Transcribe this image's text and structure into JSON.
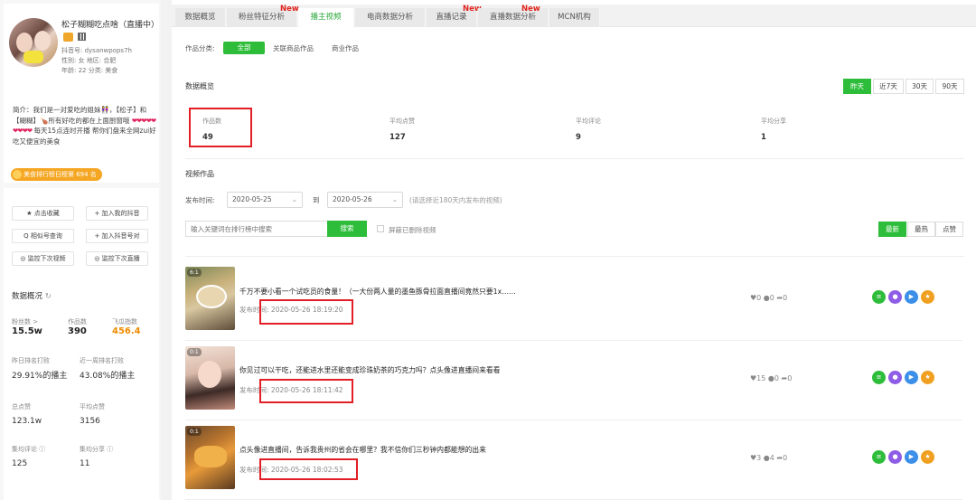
{
  "profile": {
    "name": "松子糊糊吃点啥（直播中）",
    "douyin_id": "抖音号: dysanwpops7h",
    "gender_region": "性别: 女   地区: 合肥",
    "age_category": "年龄: 22   分类: 美食",
    "bio_1": "简介：我们是一对爱吃的姐妹👭，【松子】和【糊糊】🍗所有好吃的都在上面厨窗哦",
    "bio_hearts": "❤❤❤❤❤❤❤❤❤",
    "bio_2": "每天15点连时开播 帮你们盘来全网zui好吃又便宜的美食",
    "rank_badge": "美食排行榜日榜第 694 名"
  },
  "actions": {
    "collect": "★ 点击收藏",
    "add_my_douyin": "+ 加入我的抖音",
    "similar_search": "Q 相似号查询",
    "add_compare": "+ 加入抖音号对",
    "monitor_video": "◎ 监控下次视频",
    "monitor_live": "◎ 监控下次直播"
  },
  "side_stats": {
    "title": "数据概况",
    "fans_label": "粉丝数 >",
    "fans_value": "15.5w",
    "works_label": "作品数",
    "works_value": "390",
    "fg_label": "飞瓜指数",
    "fg_value": "456.4",
    "prev_rank_label": "昨日排名打败",
    "prev_rank_value": "29.91%的播主",
    "week_rank_label": "近一周排名打败",
    "week_rank_value": "43.08%的播主",
    "total_likes_label": "总点赞",
    "total_likes_value": "123.1w",
    "avg_likes_label": "平均点赞",
    "avg_likes_value": "3156",
    "avg_comments_label": "集均评论 ⓘ",
    "avg_comments_value": "125",
    "avg_shares_label": "集均分享 ⓘ",
    "avg_shares_value": "11"
  },
  "tabs": [
    {
      "label": "数据概览",
      "new": ""
    },
    {
      "label": "粉丝特征分析",
      "new": "New"
    },
    {
      "label": "播主视频",
      "new": ""
    },
    {
      "label": "电商数据分析",
      "new": ""
    },
    {
      "label": "直播记录",
      "new": "New"
    },
    {
      "label": "直播数据分析",
      "new": "New"
    },
    {
      "label": "MCN机构",
      "new": ""
    }
  ],
  "filter": {
    "category_label": "作品分类:",
    "all": "全部",
    "related_goods": "关联商品作品",
    "commercial": "商业作品"
  },
  "overview": {
    "title": "数据概览",
    "ranges": [
      "昨天",
      "近7天",
      "30天",
      "90天"
    ],
    "works_label": "作品数",
    "works_value": "49",
    "avg_likes_label": "平均点赞",
    "avg_likes_value": "127",
    "avg_comments_label": "平均评论",
    "avg_comments_value": "9",
    "avg_shares_label": "平均分享",
    "avg_shares_value": "1"
  },
  "videos_section": {
    "title": "视频作品",
    "publish_label": "发布时间:",
    "date_from": "2020-05-25",
    "to": "到",
    "date_to": "2020-05-26",
    "date_hint": "(请选择近180天内发布的视频)",
    "search_placeholder": "输入关键词在排行榜中搜索",
    "search_button": "搜索",
    "hide_deleted": "屏蔽已删除视频",
    "sorts": [
      "最新",
      "最热",
      "点赞"
    ]
  },
  "videos": [
    {
      "duration": "6:1",
      "title": "千万不要小看一个试吃员的食量！（一大份两人量的墨鱼豚骨拉面直播间竟然只要1x……",
      "time_label": "发布时间:",
      "time": "2020-05-26 18:19:20",
      "stats": "♥0  ●0  ➦0"
    },
    {
      "duration": "0:1",
      "title": "你见过可以干吃，还能进水里还能变成珍珠奶茶的巧克力吗？点头像进直播间来看看",
      "time_label": "发布时间:",
      "time": "2020-05-26 18:11:42",
      "stats": "♥15  ●0  ➦0"
    },
    {
      "duration": "0:1",
      "title": "点头像进直播间，告诉我贵州的省会在哪里？我不信你们三秒钟内都能想的出来",
      "time_label": "发布时间:",
      "time": "2020-05-26 18:02:53",
      "stats": "♥3  ●4  ➦0"
    }
  ],
  "colors": {
    "accent": "#2ebd3a",
    "highlight_box": "#e21f26",
    "new_tag": "#e0231e"
  }
}
